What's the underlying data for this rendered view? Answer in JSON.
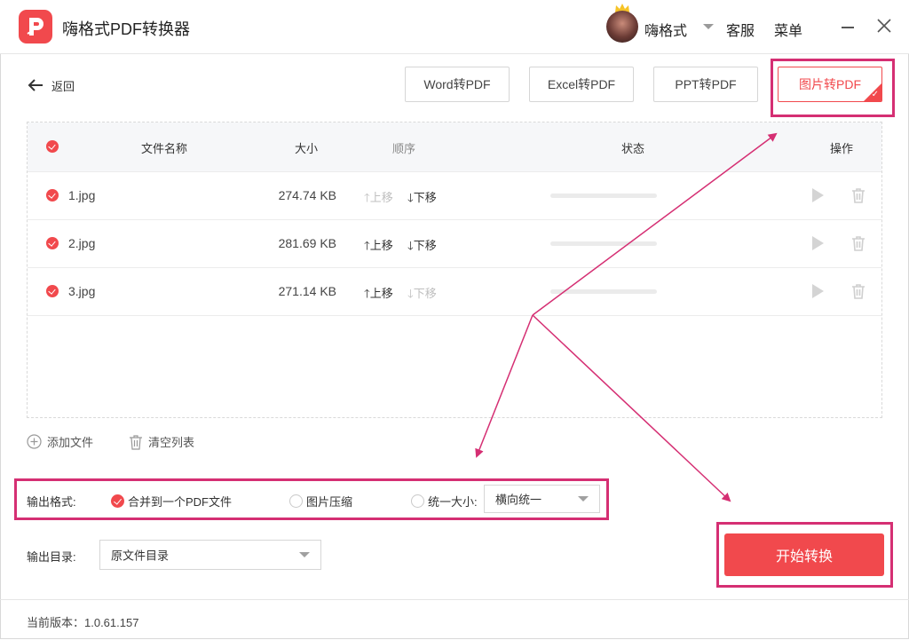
{
  "app": {
    "title": "嗨格式PDF转换器",
    "brand_color": "#f1494d",
    "logo_icon": "pdf-logo-icon"
  },
  "titlebar": {
    "username": "嗨格式",
    "service": "客服",
    "menu": "菜单"
  },
  "nav": {
    "back_label": "返回"
  },
  "modes": [
    {
      "label": "Word转PDF",
      "active": false
    },
    {
      "label": "Excel转PDF",
      "active": false
    },
    {
      "label": "PPT转PDF",
      "active": false
    },
    {
      "label": "图片转PDF",
      "active": true
    }
  ],
  "table": {
    "headers": {
      "name": "文件名称",
      "size": "大小",
      "order": "顺序",
      "status": "状态",
      "action": "操作"
    },
    "move_up": "上移",
    "move_down": "下移",
    "rows": [
      {
        "name": "1.jpg",
        "size": "274.74 KB",
        "up_enabled": false,
        "down_enabled": true,
        "progress": 0
      },
      {
        "name": "2.jpg",
        "size": "281.69 KB",
        "up_enabled": true,
        "down_enabled": true,
        "progress": 0
      },
      {
        "name": "3.jpg",
        "size": "271.14 KB",
        "up_enabled": true,
        "down_enabled": false,
        "progress": 0
      }
    ]
  },
  "tools": {
    "add_file": "添加文件",
    "clear_list": "清空列表"
  },
  "output_format": {
    "label": "输出格式:",
    "options": [
      {
        "label": "合并到一个PDF文件",
        "checked": true
      },
      {
        "label": "图片压缩",
        "checked": false
      },
      {
        "label": "统一大小:",
        "checked": false
      }
    ],
    "size_select": "横向统一"
  },
  "output_dir": {
    "label": "输出目录:",
    "value": "原文件目录"
  },
  "start_button": "开始转换",
  "footer": {
    "version": "当前版本：1.0.61.157"
  },
  "annotation_color": "#d52f73"
}
